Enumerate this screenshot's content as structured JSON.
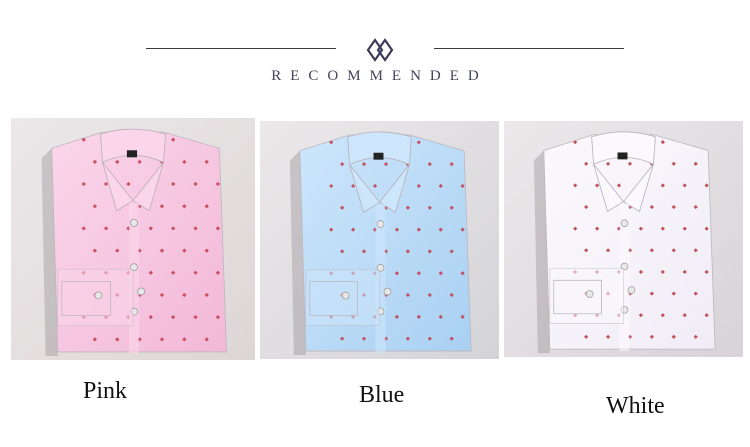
{
  "heading": "RECOMMENDED",
  "colors": {
    "line": "#3a3a46",
    "logo": "#3c3c5a"
  },
  "products": [
    {
      "label": "Pink",
      "color_name": "pink",
      "shirt": "#f2b8d8",
      "shirt_light": "#fbd6ea",
      "bg": "#ddd6d6",
      "dot": "#c23b4a"
    },
    {
      "label": "Blue",
      "color_name": "blue",
      "shirt": "#a9d0f2",
      "shirt_light": "#cde6fb",
      "bg": "#d4d4d8",
      "dot": "#c23b4a"
    },
    {
      "label": "White",
      "color_name": "white",
      "shirt": "#f1ecf6",
      "shirt_light": "#fbf9fd",
      "bg": "#d8d3d8",
      "dot": "#b8343f"
    }
  ]
}
